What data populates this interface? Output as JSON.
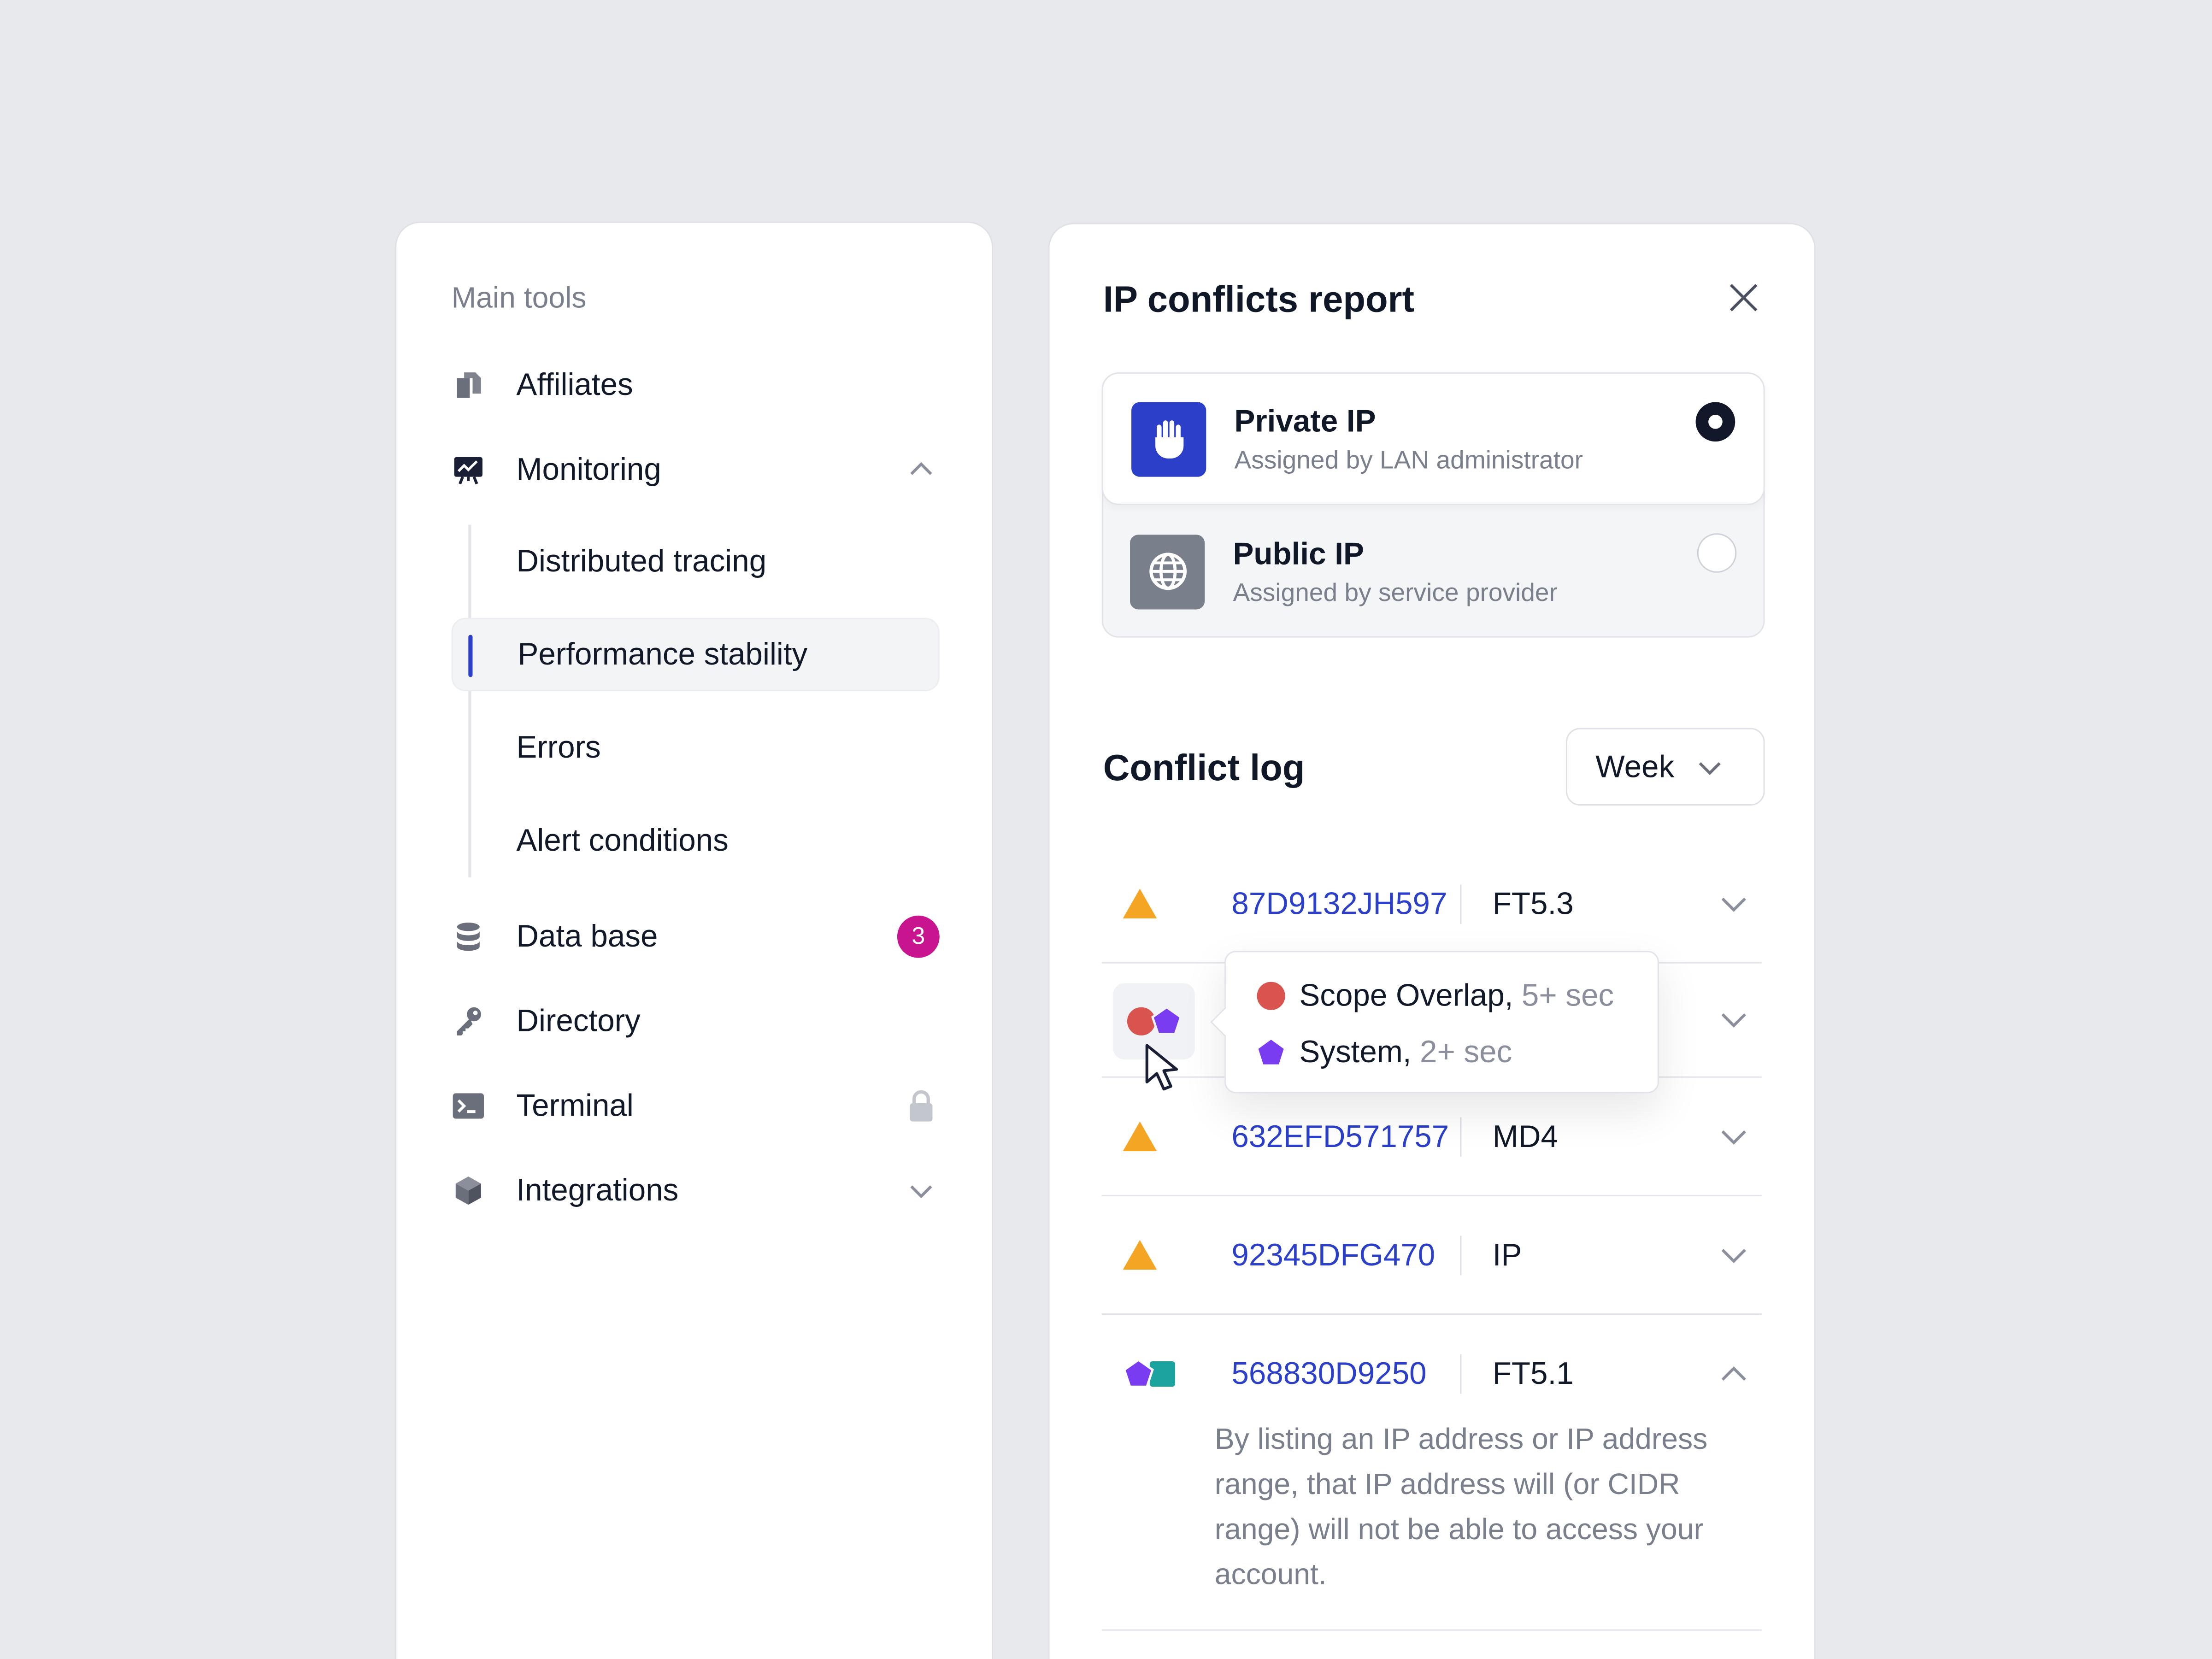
{
  "colors": {
    "accent": "#2b3fc9",
    "badge": "#c8158f",
    "warning": "#f5a524",
    "red": "#d9534f",
    "purple": "#7a3cf0",
    "teal": "#1ba3a0"
  },
  "sidebar": {
    "section_label": "Main tools",
    "items": [
      {
        "label": "Affiliates",
        "icon": "documents-icon"
      },
      {
        "label": "Monitoring",
        "icon": "chart-board-icon",
        "expanded": true
      },
      {
        "label": "Data base",
        "icon": "database-icon",
        "badge": "3"
      },
      {
        "label": "Directory",
        "icon": "key-icon"
      },
      {
        "label": "Terminal",
        "icon": "terminal-icon",
        "locked": true
      },
      {
        "label": "Integrations",
        "icon": "cube-icon",
        "expanded": false
      }
    ],
    "sub_items": [
      {
        "label": "Distributed tracing"
      },
      {
        "label": "Performance stability",
        "active": true
      },
      {
        "label": "Errors"
      },
      {
        "label": "Alert conditions"
      }
    ]
  },
  "report": {
    "title": "IP conflicts report",
    "options": [
      {
        "title": "Private IP",
        "subtitle": "Assigned by LAN administrator",
        "selected": true,
        "icon": "hand-icon"
      },
      {
        "title": "Public IP",
        "subtitle": "Assigned by service provider",
        "selected": false,
        "icon": "globe-icon"
      }
    ],
    "log_title": "Conflict log",
    "period": "Week",
    "rows": [
      {
        "id": "87D9132JH597",
        "type": "FT5.3",
        "icon": "warning-icon"
      },
      {
        "id": "",
        "type": "",
        "icon": "multi-icon"
      },
      {
        "id": "632EFD571757",
        "type": "MD4",
        "icon": "warning-icon"
      },
      {
        "id": "92345DFG470",
        "type": "IP",
        "icon": "warning-icon"
      },
      {
        "id": "568830D9250",
        "type": "FT5.1",
        "icon": "pentagon-square-icon",
        "expanded": true,
        "description": "By listing an IP address or IP address range, that IP address will (or CIDR range) will not be able to access your account."
      }
    ],
    "tooltip": [
      {
        "label": "Scope Overlap,",
        "detail": "5+ sec",
        "icon": "red-circle-icon"
      },
      {
        "label": "System,",
        "detail": "2+ sec",
        "icon": "purple-pentagon-icon"
      }
    ]
  }
}
